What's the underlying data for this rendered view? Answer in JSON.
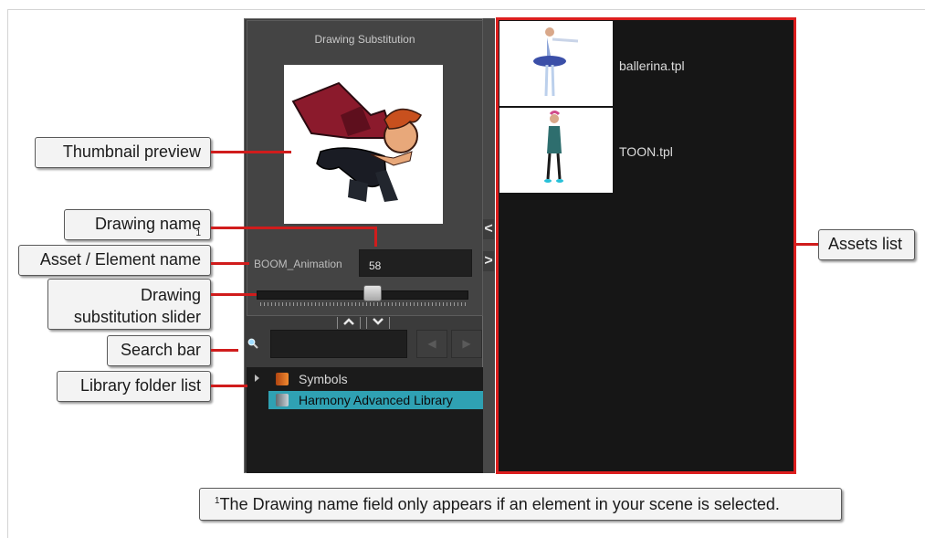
{
  "panel": {
    "title": "Drawing Substitution",
    "element_name": "BOOM_Animation",
    "drawing_name": "58",
    "slider_level": 0.55,
    "collapse_up": "^",
    "collapse_down": "v",
    "prev_button": "◀",
    "next_button": "▶",
    "folders": [
      {
        "label": "Symbols",
        "selected": false,
        "icon": "orange-book-icon"
      },
      {
        "label": "Harmony Advanced Library",
        "selected": true,
        "icon": "grey-book-icon"
      }
    ]
  },
  "side_arrows": {
    "left": "<",
    "right": ">"
  },
  "assets": [
    {
      "label": "ballerina.tpl"
    },
    {
      "label": "TOON.tpl"
    }
  ],
  "callouts": {
    "thumbnail": "Thumbnail preview",
    "drawing_name": "Drawing name",
    "drawing_name_sup": "1",
    "asset_element": "Asset / Element name",
    "slider_line1": "Drawing",
    "slider_line2": "substitution slider",
    "search": "Search bar",
    "library": "Library folder list",
    "assets": "Assets list"
  },
  "footnote": {
    "sup": "1",
    "text": "The Drawing name field only appears if an element in your scene is selected."
  },
  "colors": {
    "accent_red": "#dc1e1e",
    "selection": "#2fa1b3",
    "panel": "#3b3b3b"
  }
}
